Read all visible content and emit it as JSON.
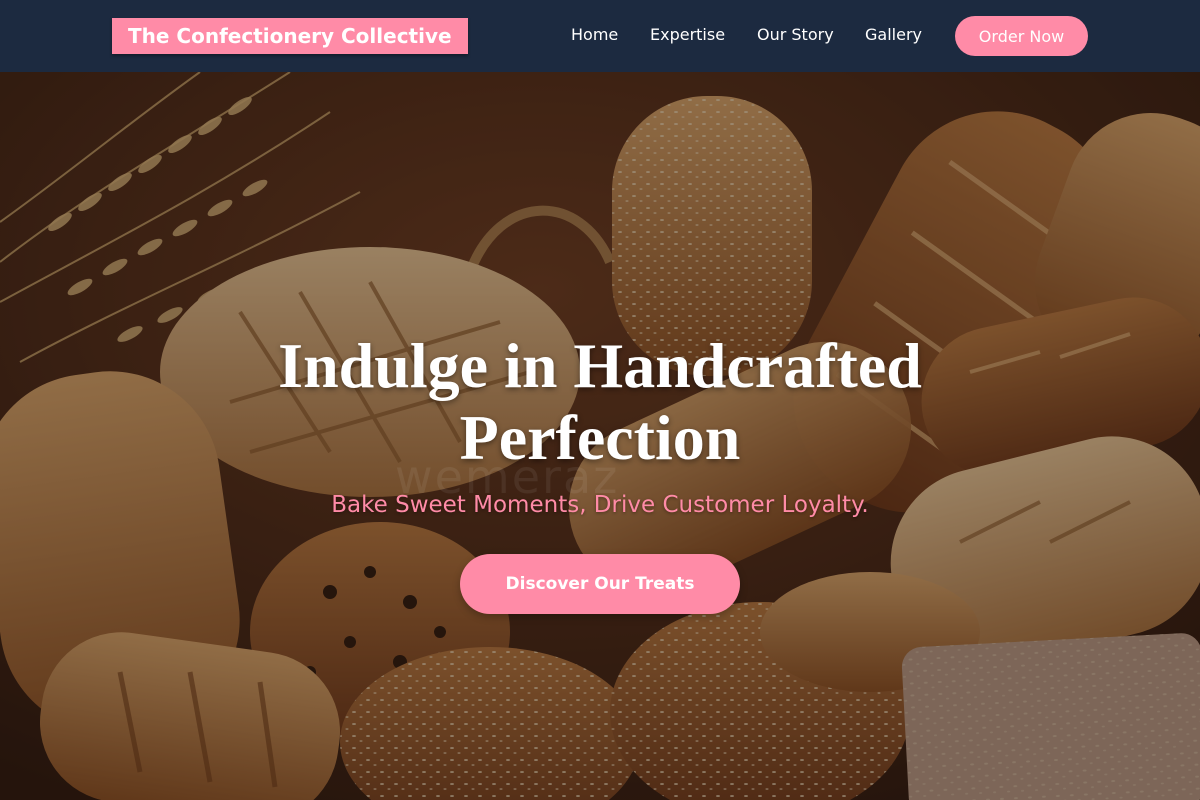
{
  "brand": {
    "name": "The Confectionery Collective"
  },
  "nav": {
    "items": [
      {
        "label": "Home"
      },
      {
        "label": "Expertise"
      },
      {
        "label": "Our Story"
      },
      {
        "label": "Gallery"
      }
    ],
    "cta_label": "Order Now"
  },
  "hero": {
    "title": "Indulge in Handcrafted Perfection",
    "subtitle": "Bake Sweet Moments, Drive Customer Loyalty.",
    "cta_label": "Discover Our Treats",
    "watermark": "wemeraz"
  },
  "colors": {
    "navbar_bg": "#1c2a40",
    "accent": "#ff8ba7",
    "text_light": "#ffffff"
  },
  "icons": {
    "hero_background": "bread-basket-image"
  }
}
